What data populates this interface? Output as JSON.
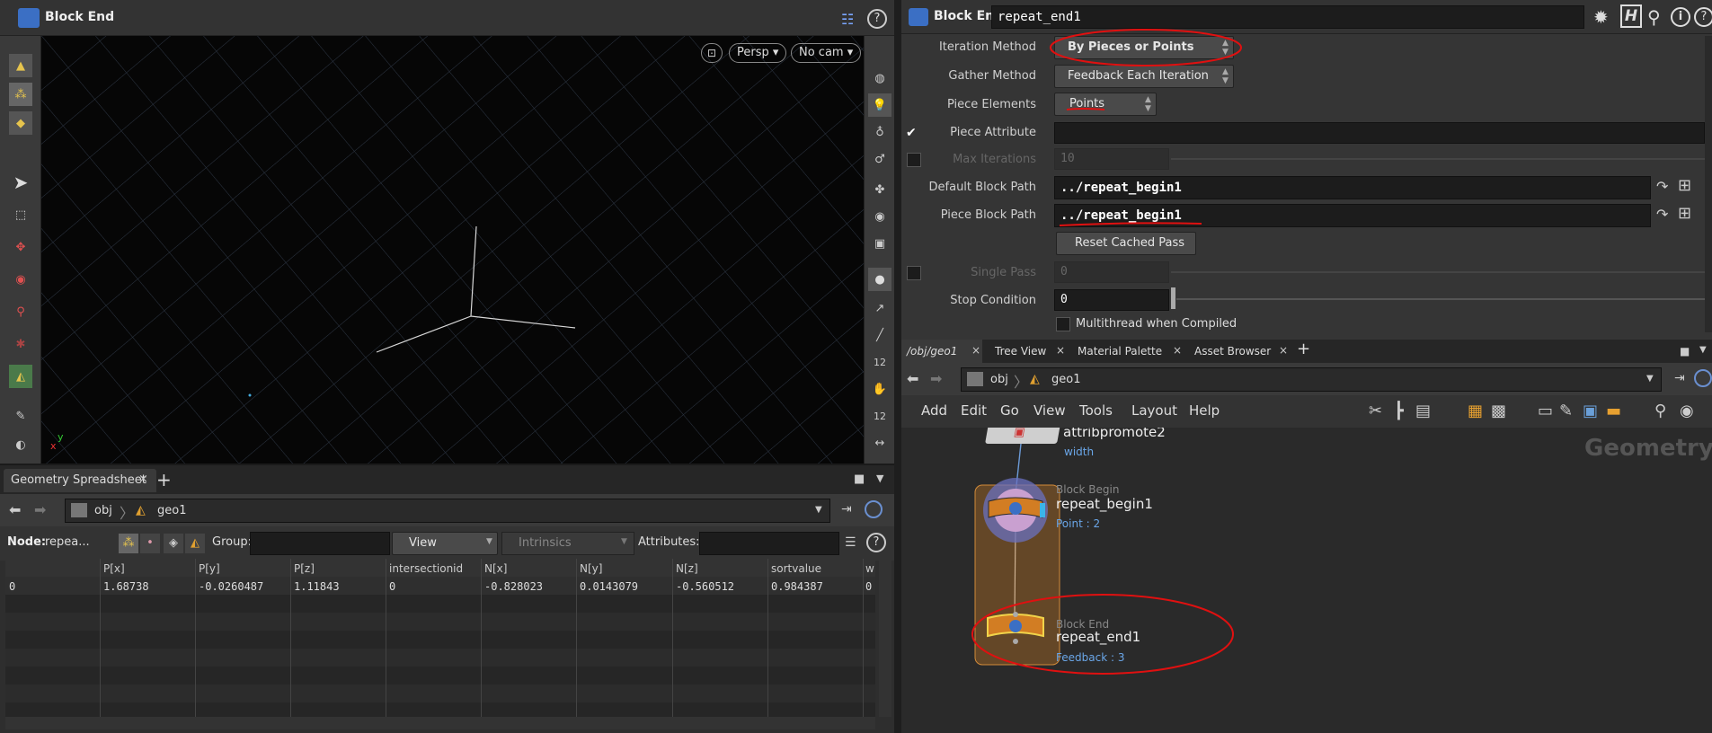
{
  "viewport": {
    "title": "Block End",
    "persp": "Persp",
    "cam": "No cam",
    "axis_x": "x",
    "axis_y": "y"
  },
  "params": {
    "node_type": "Block End",
    "node_name": "repeat_end1",
    "iteration_method_label": "Iteration Method",
    "iteration_method": "By Pieces or Points",
    "gather_method_label": "Gather Method",
    "gather_method": "Feedback Each Iteration",
    "piece_elements_label": "Piece Elements",
    "piece_elements": "Points",
    "piece_attribute_label": "Piece Attribute",
    "piece_attribute": "",
    "max_iterations_label": "Max Iterations",
    "max_iterations": "10",
    "default_block_path_label": "Default Block Path",
    "default_block_path": "../repeat_begin1",
    "piece_block_path_label": "Piece Block Path",
    "piece_block_path": "../repeat_begin1",
    "reset_button": "Reset Cached Pass",
    "single_pass_label": "Single Pass",
    "single_pass": "0",
    "stop_condition_label": "Stop Condition",
    "stop_condition": "0",
    "multithread_label": "Multithread when Compiled"
  },
  "network": {
    "tabs": [
      {
        "label": "/obj/geo1"
      },
      {
        "label": "Tree View"
      },
      {
        "label": "Material Palette"
      },
      {
        "label": "Asset Browser"
      }
    ],
    "path_obj": "obj",
    "path_geo": "geo1",
    "menu": [
      "Add",
      "Edit",
      "Go",
      "View",
      "Tools",
      "Layout",
      "Help"
    ],
    "context_label": "Geometry",
    "nodes": {
      "attrib_name": "attribpromote2",
      "attrib_sub": "width",
      "begin_type": "Block Begin",
      "begin_name": "repeat_begin1",
      "begin_sub": "Point : 2",
      "end_type": "Block End",
      "end_name": "repeat_end1",
      "end_sub": "Feedback : 3"
    }
  },
  "spreadsheet": {
    "tab": "Geometry Spreadsheet",
    "path_obj": "obj",
    "path_geo": "geo1",
    "node_label": "Node:",
    "node_value": "repea...",
    "group_label": "Group:",
    "view_label": "View",
    "intrinsics_label": "Intrinsics",
    "attributes_label": "Attributes:",
    "columns": [
      "",
      "P[x]",
      "P[y]",
      "P[z]",
      "intersectionid",
      "N[x]",
      "N[y]",
      "N[z]",
      "sortvalue",
      "w"
    ],
    "row": [
      "0",
      "1.68738",
      "-0.0260487",
      "1.11843",
      "0",
      "-0.828023",
      "0.0143079",
      "-0.560512",
      "0.984387",
      "0"
    ]
  }
}
